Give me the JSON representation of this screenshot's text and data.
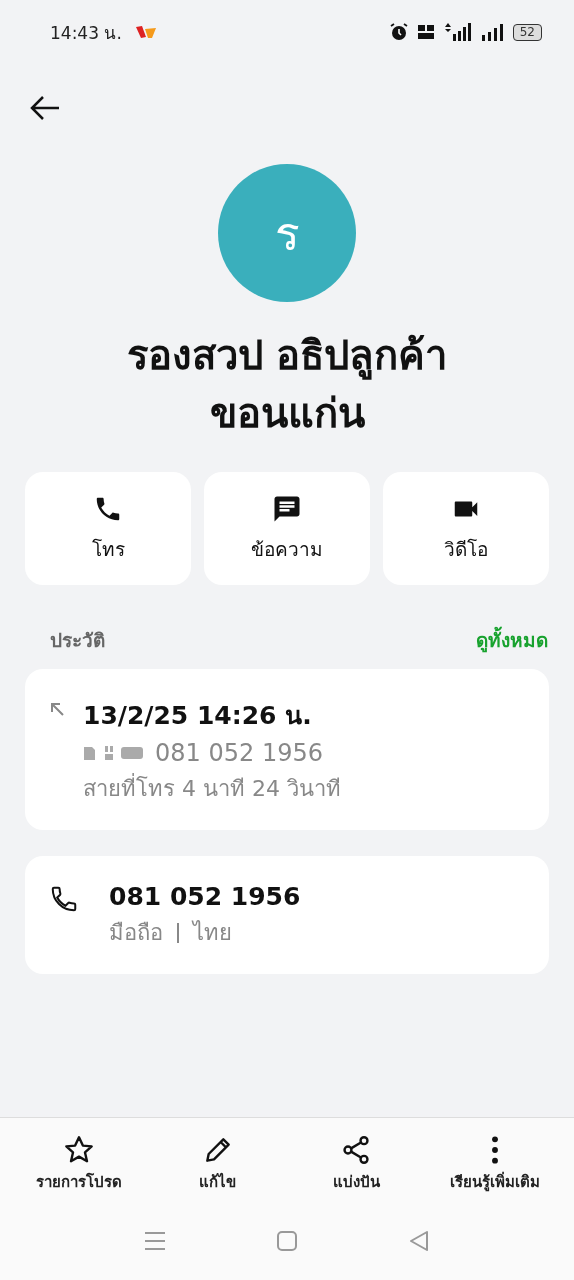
{
  "status_bar": {
    "time": "14:43 น.",
    "battery": "52"
  },
  "contact": {
    "initial": "ร",
    "name": "รองสวป อธิปลูกค้า ขอนแก่น"
  },
  "actions": [
    {
      "kind": "call",
      "label": "โทร"
    },
    {
      "kind": "message",
      "label": "ข้อความ"
    },
    {
      "kind": "video",
      "label": "วิดีโอ"
    }
  ],
  "history": {
    "title": "ประวัติ",
    "see_all": "ดูทั้งหมด",
    "entries": [
      {
        "kind": "outgoing",
        "datetime": "13/2/25 14:26 น.",
        "number": "081 052 1956",
        "detail": "สายที่โทร  4 นาที 24 วินาที"
      }
    ]
  },
  "phone": {
    "number": "081 052 1956",
    "type": "มือถือ",
    "region": "ไทย"
  },
  "bottom_bar": [
    {
      "kind": "favorite",
      "label": "รายการโปรด"
    },
    {
      "kind": "edit",
      "label": "แก้ไข"
    },
    {
      "kind": "share",
      "label": "แบ่งปัน"
    },
    {
      "kind": "more",
      "label": "เรียนรู้เพิ่มเติม"
    }
  ]
}
